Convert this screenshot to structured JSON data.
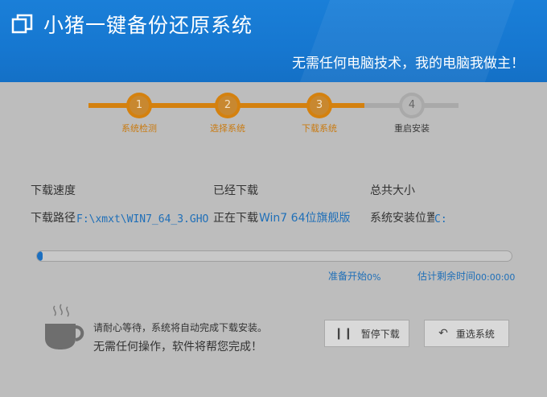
{
  "header": {
    "title": "小猪一键备份还原系统",
    "slogan": "无需任何电脑技术，我的电脑我做主！"
  },
  "steps": [
    {
      "num": "1",
      "label": "系统检测",
      "state": "done"
    },
    {
      "num": "2",
      "label": "选择系统",
      "state": "done"
    },
    {
      "num": "3",
      "label": "下载系统",
      "state": "done"
    },
    {
      "num": "4",
      "label": "重启安装",
      "state": "todo"
    }
  ],
  "info": {
    "speed_label": "下载速度",
    "downloaded_label": "已经下载",
    "total_label": "总共大小",
    "path_label": "下载路径",
    "path_value": "F:\\xmxt\\WIN7_64_3.GHO",
    "downloading_label": "正在下载",
    "downloading_value": "Win7 64位旗舰版",
    "install_pos_label": "系统安装位置",
    "install_pos_value": "C:"
  },
  "progress": {
    "fraction": 0.01,
    "status_label": "准备开始",
    "percent": "0%",
    "remaining_label": "估计剩余时间",
    "remaining_value": "00:00:00"
  },
  "tip": {
    "line1": "请耐心等待，系统将自动完成下载安装。",
    "line2": "无需任何操作，软件将帮您完成！"
  },
  "buttons": {
    "pause": "暂停下载",
    "reselect": "重选系统"
  },
  "colors": {
    "header_blue": "#1677d0",
    "step_orange": "#d4810f",
    "value_blue": "#1f6fb8"
  }
}
